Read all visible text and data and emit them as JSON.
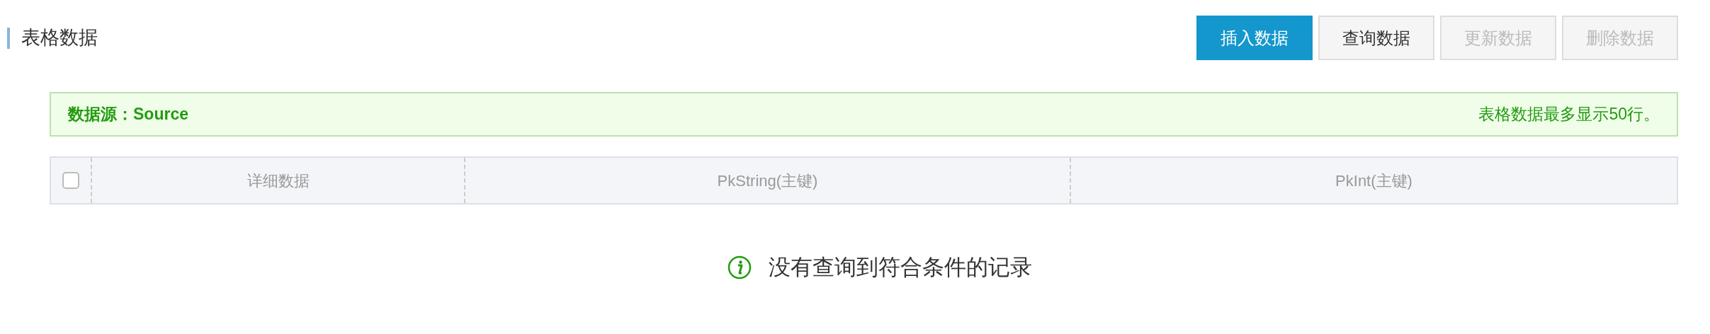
{
  "header": {
    "title": "表格数据"
  },
  "buttons": [
    {
      "label": "插入数据",
      "kind": "primary",
      "disabled": false
    },
    {
      "label": "查询数据",
      "kind": "default",
      "disabled": false
    },
    {
      "label": "更新数据",
      "kind": "default",
      "disabled": true
    },
    {
      "label": "删除数据",
      "kind": "default",
      "disabled": true
    }
  ],
  "alert": {
    "source": "数据源：Source",
    "note": "表格数据最多显示50行。"
  },
  "table": {
    "select_all": {
      "checked": false
    },
    "columns": [
      "详细数据",
      "PkString(主键)",
      "PkInt(主键)"
    ]
  },
  "empty_message": "没有查询到符合条件的记录"
}
